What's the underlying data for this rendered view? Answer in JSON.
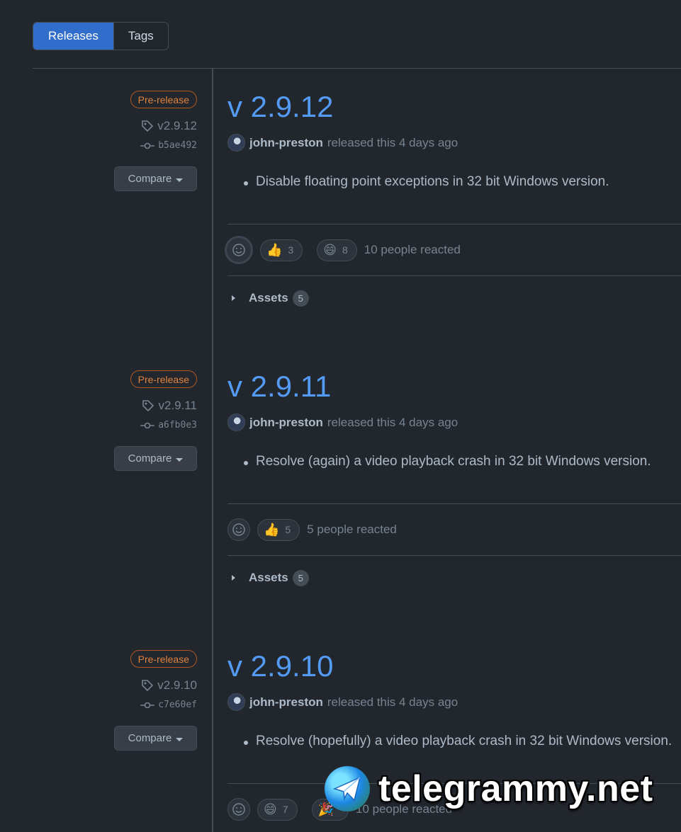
{
  "tabs": {
    "releases": "Releases",
    "tags": "Tags"
  },
  "releases": [
    {
      "badge": "Pre-release",
      "tag": "v2.9.12",
      "commit": "b5ae492",
      "compare": "Compare",
      "title": "v 2.9.12",
      "author": "john-preston",
      "released_text": "released this 4 days ago",
      "note": "Disable floating point exceptions in 32 bit Windows version.",
      "reactions": [
        {
          "emoji": "👍",
          "count": "3"
        },
        {
          "emoji": "😄",
          "count": "8"
        }
      ],
      "reaction_summary": "10 people reacted",
      "assets_label": "Assets",
      "assets_count": "5"
    },
    {
      "badge": "Pre-release",
      "tag": "v2.9.11",
      "commit": "a6fb0e3",
      "compare": "Compare",
      "title": "v 2.9.11",
      "author": "john-preston",
      "released_text": "released this 4 days ago",
      "note": "Resolve (again) a video playback crash in 32 bit Windows version.",
      "reactions": [
        {
          "emoji": "👍",
          "count": "5"
        }
      ],
      "reaction_summary": "5 people reacted",
      "assets_label": "Assets",
      "assets_count": "5"
    },
    {
      "badge": "Pre-release",
      "tag": "v2.9.10",
      "commit": "c7e60ef",
      "compare": "Compare",
      "title": "v 2.9.10",
      "author": "john-preston",
      "released_text": "released this 4 days ago",
      "note": "Resolve (hopefully) a video playback crash in 32 bit Windows version.",
      "reactions": [
        {
          "emoji": "😄",
          "count": "7"
        },
        {
          "emoji": "🎉",
          "count": ""
        }
      ],
      "reaction_summary": "10 people reacted"
    }
  ],
  "watermark": {
    "text": "telegrammy.net",
    "icon": "paper-plane-globe-icon"
  },
  "colors": {
    "accent": "#316dca",
    "title": "#539bf5",
    "prerelease": "#e0823d",
    "background": "#22272e"
  }
}
